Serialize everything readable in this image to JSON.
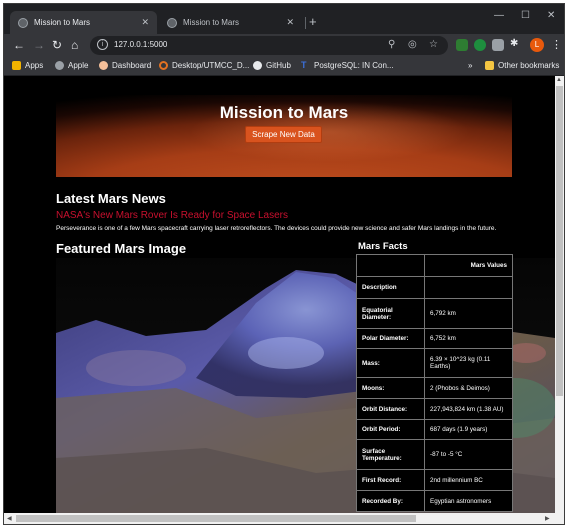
{
  "browser": {
    "tabs": [
      {
        "title": "Mission to Mars",
        "active": true
      },
      {
        "title": "Mission to Mars",
        "active": false
      }
    ],
    "url": "127.0.0.1:5000",
    "profile_initial": "L",
    "bookmarks": [
      {
        "label": "Apps",
        "icon": "apps-grid-icon",
        "color": "#f4b400"
      },
      {
        "label": "Apple",
        "icon": "apple-icon",
        "color": "#9aa0a6"
      },
      {
        "label": "Dashboard",
        "icon": "dashboard-icon",
        "color": "#f5c09a"
      },
      {
        "label": "Desktop/UTMCC_D...",
        "icon": "orange-ring-icon",
        "color": "#e37222"
      },
      {
        "label": "GitHub",
        "icon": "github-icon",
        "color": "#e8eaed"
      },
      {
        "label": "PostgreSQL: IN Con...",
        "icon": "postgres-t-icon",
        "color": "#3b6fd9"
      }
    ],
    "other_bookmarks": "Other bookmarks"
  },
  "page": {
    "title": "Mission to Mars",
    "scrape_button": "Scrape New Data",
    "news_heading": "Latest Mars News",
    "news_title": "NASA's New Mars Rover Is Ready for Space Lasers",
    "news_paragraph": "Perseverance is one of a few Mars spacecraft carrying laser retroreflectors. The devices could provide new science and safer Mars landings in the future.",
    "featured_heading": "Featured Mars Image",
    "facts_heading": "Mars Facts",
    "facts_header_value": "Mars Values",
    "facts": [
      {
        "k": "Description",
        "v": ""
      },
      {
        "k": "Equatorial Diameter:",
        "v": "6,792 km"
      },
      {
        "k": "Polar Diameter:",
        "v": "6,752 km"
      },
      {
        "k": "Mass:",
        "v": "6.39 × 10^23 kg (0.11 Earths)"
      },
      {
        "k": "Moons:",
        "v": "2 (Phobos & Deimos)"
      },
      {
        "k": "Orbit Distance:",
        "v": "227,943,824 km (1.38 AU)"
      },
      {
        "k": "Orbit Period:",
        "v": "687 days (1.9 years)"
      },
      {
        "k": "Surface Temperature:",
        "v": "-87 to -5 °C"
      },
      {
        "k": "First Record:",
        "v": "2nd millennium BC"
      },
      {
        "k": "Recorded By:",
        "v": "Egyptian astronomers"
      }
    ]
  }
}
